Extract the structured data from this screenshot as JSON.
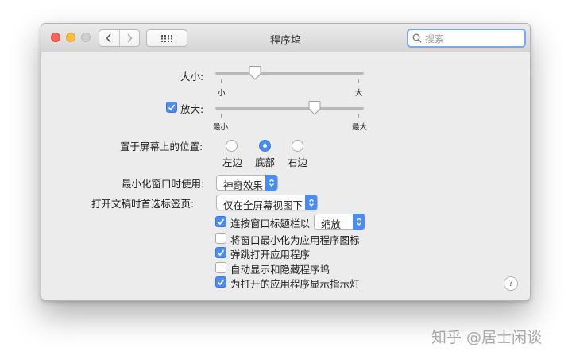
{
  "window": {
    "title": "程序坞"
  },
  "search": {
    "placeholder": "搜索"
  },
  "size": {
    "label": "大小:",
    "min_label": "小",
    "max_label": "大",
    "value": 0.27
  },
  "magnification": {
    "label": "放大:",
    "checked": true,
    "min_label": "最小",
    "max_label": "最大",
    "value": 0.67
  },
  "position": {
    "label": "置于屏幕上的位置:",
    "options": [
      "左边",
      "底部",
      "右边"
    ],
    "selected": "底部"
  },
  "minimize_effect": {
    "label": "最小化窗口时使用:",
    "value": "神奇效果"
  },
  "prefer_tabs": {
    "label": "打开文稿时首选标签页:",
    "value": "仅在全屏幕视图下"
  },
  "options": {
    "double_click": {
      "label": "连按窗口标题栏以",
      "checked": true,
      "select_value": "缩放"
    },
    "minimize_into_app": {
      "label": "将窗口最小化为应用程序图标",
      "checked": false
    },
    "animate_opening": {
      "label": "弹跳打开应用程序",
      "checked": true
    },
    "autohide": {
      "label": "自动显示和隐藏程序坞",
      "checked": false
    },
    "show_indicators": {
      "label": "为打开的应用程序显示指示灯",
      "checked": true
    }
  },
  "help": {
    "label": "?"
  },
  "watermark": {
    "text": "知乎 @居士闲谈"
  },
  "icons": [
    "back-chevron-icon",
    "forward-chevron-icon",
    "grid-icon",
    "search-icon",
    "checkmark-icon",
    "popup-arrows-icon",
    "help-icon"
  ]
}
